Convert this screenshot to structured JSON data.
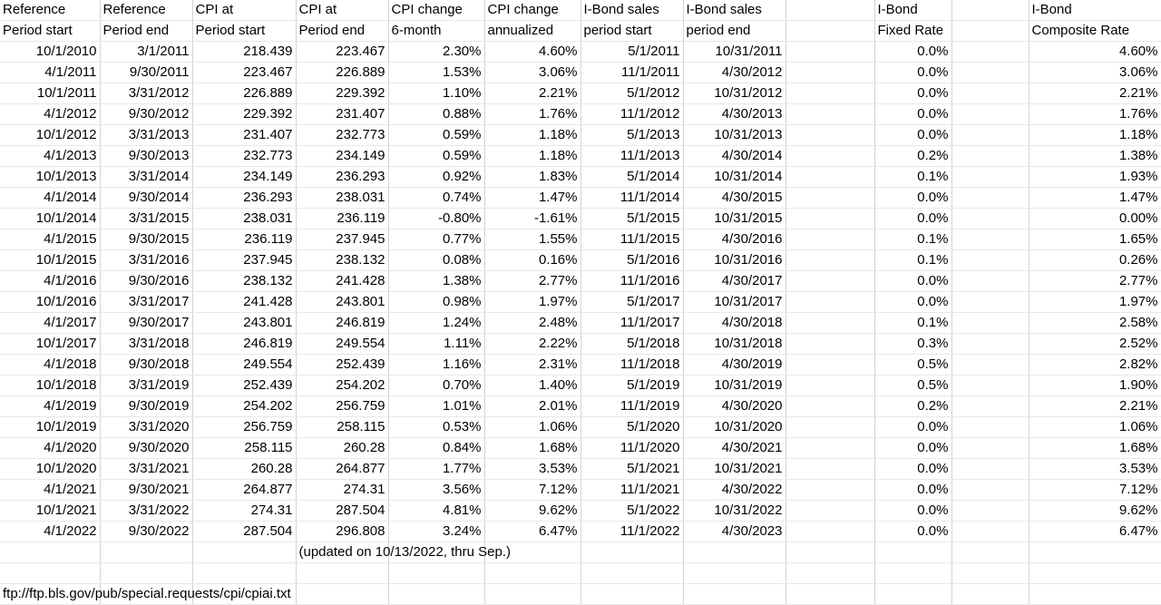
{
  "app": {
    "type": "spreadsheet",
    "grid_line_color": "#d4d4d4",
    "background_color": "#ffffff",
    "text_color": "#000000"
  },
  "headers": {
    "row1": [
      "Reference",
      "Reference",
      "CPI at",
      "CPI at",
      "CPI change",
      "CPI change",
      "I-Bond sales",
      "I-Bond sales",
      "",
      "I-Bond",
      "",
      "I-Bond"
    ],
    "row2": [
      "Period start",
      "Period end",
      "Period start",
      "Period end",
      "6-month",
      "annualized",
      "period start",
      "period end",
      "",
      "Fixed Rate",
      "",
      "Composite Rate"
    ]
  },
  "columns": [
    {
      "key": "ref_start",
      "label": "Reference Period start",
      "align": "right"
    },
    {
      "key": "ref_end",
      "label": "Reference Period end",
      "align": "right"
    },
    {
      "key": "cpi_start",
      "label": "CPI at Period start",
      "align": "right"
    },
    {
      "key": "cpi_end",
      "label": "CPI at Period end",
      "align": "right"
    },
    {
      "key": "cpi_6mo",
      "label": "CPI change 6-month",
      "align": "right"
    },
    {
      "key": "cpi_annual",
      "label": "CPI change annualized",
      "align": "right"
    },
    {
      "key": "sale_start",
      "label": "I-Bond sales period start",
      "align": "right"
    },
    {
      "key": "sale_end",
      "label": "I-Bond sales period end",
      "align": "right"
    },
    {
      "key": "gap1",
      "label": "",
      "align": "right"
    },
    {
      "key": "fixed_rate",
      "label": "I-Bond Fixed Rate",
      "align": "right"
    },
    {
      "key": "gap2",
      "label": "",
      "align": "right"
    },
    {
      "key": "composite_rate",
      "label": "I-Bond Composite Rate",
      "align": "right"
    }
  ],
  "rows": [
    [
      "10/1/2010",
      "3/1/2011",
      "218.439",
      "223.467",
      "2.30%",
      "4.60%",
      "5/1/2011",
      "10/31/2011",
      "",
      "0.0%",
      "",
      "4.60%"
    ],
    [
      "4/1/2011",
      "9/30/2011",
      "223.467",
      "226.889",
      "1.53%",
      "3.06%",
      "11/1/2011",
      "4/30/2012",
      "",
      "0.0%",
      "",
      "3.06%"
    ],
    [
      "10/1/2011",
      "3/31/2012",
      "226.889",
      "229.392",
      "1.10%",
      "2.21%",
      "5/1/2012",
      "10/31/2012",
      "",
      "0.0%",
      "",
      "2.21%"
    ],
    [
      "4/1/2012",
      "9/30/2012",
      "229.392",
      "231.407",
      "0.88%",
      "1.76%",
      "11/1/2012",
      "4/30/2013",
      "",
      "0.0%",
      "",
      "1.76%"
    ],
    [
      "10/1/2012",
      "3/31/2013",
      "231.407",
      "232.773",
      "0.59%",
      "1.18%",
      "5/1/2013",
      "10/31/2013",
      "",
      "0.0%",
      "",
      "1.18%"
    ],
    [
      "4/1/2013",
      "9/30/2013",
      "232.773",
      "234.149",
      "0.59%",
      "1.18%",
      "11/1/2013",
      "4/30/2014",
      "",
      "0.2%",
      "",
      "1.38%"
    ],
    [
      "10/1/2013",
      "3/31/2014",
      "234.149",
      "236.293",
      "0.92%",
      "1.83%",
      "5/1/2014",
      "10/31/2014",
      "",
      "0.1%",
      "",
      "1.93%"
    ],
    [
      "4/1/2014",
      "9/30/2014",
      "236.293",
      "238.031",
      "0.74%",
      "1.47%",
      "11/1/2014",
      "4/30/2015",
      "",
      "0.0%",
      "",
      "1.47%"
    ],
    [
      "10/1/2014",
      "3/31/2015",
      "238.031",
      "236.119",
      "-0.80%",
      "-1.61%",
      "5/1/2015",
      "10/31/2015",
      "",
      "0.0%",
      "",
      "0.00%"
    ],
    [
      "4/1/2015",
      "9/30/2015",
      "236.119",
      "237.945",
      "0.77%",
      "1.55%",
      "11/1/2015",
      "4/30/2016",
      "",
      "0.1%",
      "",
      "1.65%"
    ],
    [
      "10/1/2015",
      "3/31/2016",
      "237.945",
      "238.132",
      "0.08%",
      "0.16%",
      "5/1/2016",
      "10/31/2016",
      "",
      "0.1%",
      "",
      "0.26%"
    ],
    [
      "4/1/2016",
      "9/30/2016",
      "238.132",
      "241.428",
      "1.38%",
      "2.77%",
      "11/1/2016",
      "4/30/2017",
      "",
      "0.0%",
      "",
      "2.77%"
    ],
    [
      "10/1/2016",
      "3/31/2017",
      "241.428",
      "243.801",
      "0.98%",
      "1.97%",
      "5/1/2017",
      "10/31/2017",
      "",
      "0.0%",
      "",
      "1.97%"
    ],
    [
      "4/1/2017",
      "9/30/2017",
      "243.801",
      "246.819",
      "1.24%",
      "2.48%",
      "11/1/2017",
      "4/30/2018",
      "",
      "0.1%",
      "",
      "2.58%"
    ],
    [
      "10/1/2017",
      "3/31/2018",
      "246.819",
      "249.554",
      "1.11%",
      "2.22%",
      "5/1/2018",
      "10/31/2018",
      "",
      "0.3%",
      "",
      "2.52%"
    ],
    [
      "4/1/2018",
      "9/30/2018",
      "249.554",
      "252.439",
      "1.16%",
      "2.31%",
      "11/1/2018",
      "4/30/2019",
      "",
      "0.5%",
      "",
      "2.82%"
    ],
    [
      "10/1/2018",
      "3/31/2019",
      "252.439",
      "254.202",
      "0.70%",
      "1.40%",
      "5/1/2019",
      "10/31/2019",
      "",
      "0.5%",
      "",
      "1.90%"
    ],
    [
      "4/1/2019",
      "9/30/2019",
      "254.202",
      "256.759",
      "1.01%",
      "2.01%",
      "11/1/2019",
      "4/30/2020",
      "",
      "0.2%",
      "",
      "2.21%"
    ],
    [
      "10/1/2019",
      "3/31/2020",
      "256.759",
      "258.115",
      "0.53%",
      "1.06%",
      "5/1/2020",
      "10/31/2020",
      "",
      "0.0%",
      "",
      "1.06%"
    ],
    [
      "4/1/2020",
      "9/30/2020",
      "258.115",
      "260.28",
      "0.84%",
      "1.68%",
      "11/1/2020",
      "4/30/2021",
      "",
      "0.0%",
      "",
      "1.68%"
    ],
    [
      "10/1/2020",
      "3/31/2021",
      "260.28",
      "264.877",
      "1.77%",
      "3.53%",
      "5/1/2021",
      "10/31/2021",
      "",
      "0.0%",
      "",
      "3.53%"
    ],
    [
      "4/1/2021",
      "9/30/2021",
      "264.877",
      "274.31",
      "3.56%",
      "7.12%",
      "11/1/2021",
      "4/30/2022",
      "",
      "0.0%",
      "",
      "7.12%"
    ],
    [
      "10/1/2021",
      "3/31/2022",
      "274.31",
      "287.504",
      "4.81%",
      "9.62%",
      "5/1/2022",
      "10/31/2022",
      "",
      "0.0%",
      "",
      "9.62%"
    ],
    [
      "4/1/2022",
      "9/30/2022",
      "287.504",
      "296.808",
      "3.24%",
      "6.47%",
      "11/1/2022",
      "4/30/2023",
      "",
      "0.0%",
      "",
      "6.47%"
    ]
  ],
  "notes": {
    "updated": "(updated on 10/13/2022, thru Sep.)",
    "source_url": "ftp://ftp.bls.gov/pub/special.requests/cpi/cpiai.txt"
  }
}
